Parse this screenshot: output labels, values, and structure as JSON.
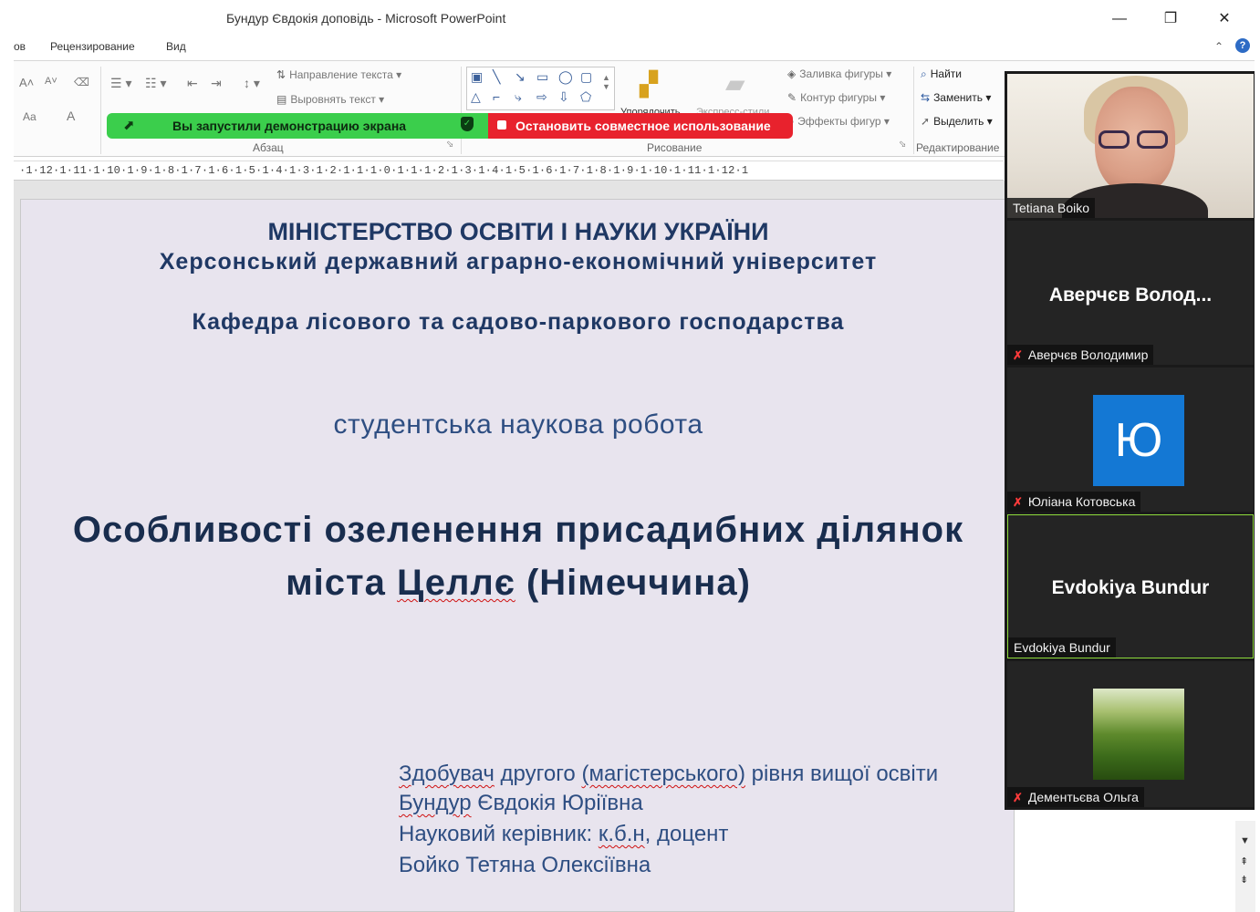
{
  "window": {
    "title": "Бундур Євдокія доповідь  -  Microsoft PowerPoint",
    "controls": {
      "minimize": "—",
      "restore": "❐",
      "close": "✕"
    }
  },
  "menu": {
    "items": [
      "ов",
      "Рецензирование",
      "Вид"
    ]
  },
  "ribbon": {
    "font": {
      "grow": "A˄",
      "shrink": "A˅",
      "case": "Aa",
      "color": "A"
    },
    "paragraph": {
      "label": "Абзац",
      "text_direction": "Направление текста",
      "align_text": "Выровнять текст"
    },
    "drawing": {
      "label": "Рисование",
      "arrange": "Упорядочить",
      "quick_styles": "Экспресс-стили",
      "shape_fill": "Заливка фигуры",
      "shape_outline": "Контур фигуры",
      "shape_effects": "Эффекты фигур"
    },
    "editing": {
      "label": "Редактирование",
      "find": "Найти",
      "replace": "Заменить",
      "select": "Выделить"
    }
  },
  "share_bar": {
    "status": "Вы запустили демонстрацию экрана",
    "stop": "Остановить совместное использование",
    "color_green": "#3bce4c",
    "color_red": "#e8222d"
  },
  "ruler": "·1·12·1·11·1·10·1·9·1·8·1·7·1·6·1·5·1·4·1·3·1·2·1·1·1·0·1·1·1·2·1·3·1·4·1·5·1·6·1·7·1·8·1·9·1·10·1·11·1·12·1",
  "slide": {
    "ministry": "МІНІСТЕРСТВО ОСВІТИ І НАУКИ УКРАЇНИ",
    "university": "Херсонський державний аграрно-економічний університет",
    "department": "Кафедра лісового та садово-паркового господарства",
    "work_type": "студентська наукова робота",
    "title_line1": "Особливості озеленення присадибних ділянок",
    "title_line2_a": "міста ",
    "title_line2_city": "Целлє",
    "title_line2_b": " (Німеччина)",
    "author_line1_a": "Здобувач",
    "author_line1_b": " другого ",
    "author_line1_c": "(магістерського)",
    "author_line1_d": "  рівня вищої освіти",
    "author_surname": "Бундур",
    "author_name": " Євдокія Юріївна",
    "supervisor_a": "Науковий керівник: ",
    "supervisor_b": "к.б.н",
    "supervisor_c": ", доцент",
    "supervisor_name": "Бойко Тетяна Олексіївна",
    "text_color": "#1f3864",
    "background": "#e8e4ee"
  },
  "participants": [
    {
      "display": "",
      "name": "Tetiana Boiko",
      "muted": false,
      "type": "video"
    },
    {
      "display": "Аверчєв Волод...",
      "name": "Аверчєв Володимир",
      "muted": true,
      "type": "name"
    },
    {
      "display": "Ю",
      "name": "Юліана Котовська",
      "muted": true,
      "type": "avatar",
      "avatar_color": "#1478d4"
    },
    {
      "display": "Evdokiya Bundur",
      "name": "Evdokiya Bundur",
      "muted": false,
      "type": "name",
      "active": true
    },
    {
      "display": "",
      "name": "Дементьєва Ольга",
      "muted": true,
      "type": "image"
    }
  ],
  "icons": {
    "mic_muted": "✗"
  }
}
